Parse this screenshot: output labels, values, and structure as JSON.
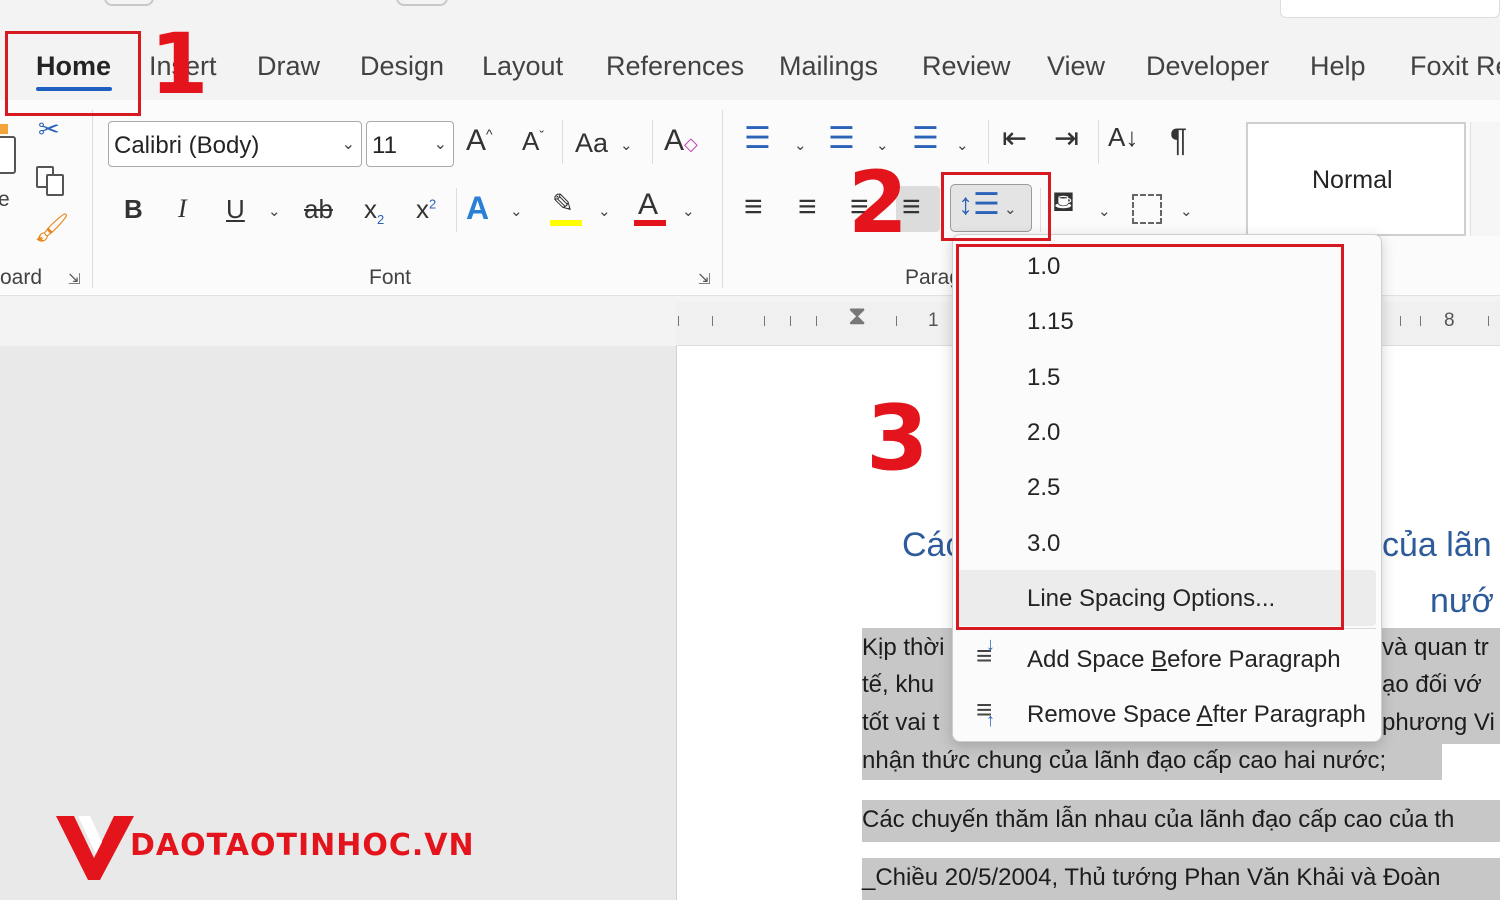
{
  "tabs": [
    {
      "label": "Home",
      "active": true
    },
    {
      "label": "Insert"
    },
    {
      "label": "Draw"
    },
    {
      "label": "Design"
    },
    {
      "label": "Layout"
    },
    {
      "label": "References"
    },
    {
      "label": "Mailings"
    },
    {
      "label": "Review"
    },
    {
      "label": "View"
    },
    {
      "label": "Developer"
    },
    {
      "label": "Help"
    },
    {
      "label": "Foxit Re"
    }
  ],
  "ribbon": {
    "clipboard_label": "oard",
    "clipboard_paste_fragment": "e",
    "font_name": "Calibri (Body)",
    "font_size": "11",
    "change_case": "Aa",
    "font_label": "Font",
    "paragraph_label": "Parag",
    "style_normal": "Normal"
  },
  "ruler": {
    "left_num": "1",
    "right_num": "8"
  },
  "line_spacing_menu": {
    "options": [
      "1.0",
      "1.15",
      "1.5",
      "2.0",
      "2.5",
      "3.0"
    ],
    "options_link": "Line Spacing Options...",
    "add_before_pre": "Add Space ",
    "add_before_key": "B",
    "add_before_post": "efore Paragraph",
    "remove_after_pre": "Remove Space ",
    "remove_after_key": "A",
    "remove_after_post": "fter Paragraph"
  },
  "document": {
    "title_left": "Các",
    "title_right": "của lãn",
    "title_line2": "nướ",
    "lines": [
      {
        "left": "Kịp thời",
        "right": "và quan tr"
      },
      {
        "left": "tế, khu",
        "right": "ạo đối vớ"
      },
      {
        "left": "tốt vai t",
        "right": "phương Vi"
      }
    ],
    "line4": "nhận thức chung của lãnh đạo cấp cao hai nước;",
    "line5": "Các chuyến thăm lẫn nhau của lãnh đạo cấp cao của th",
    "line6": "_Chiều 20/5/2004, Thủ tướng Phan Văn Khải và Đoàn"
  },
  "annotations": {
    "step1": "1",
    "step2": "2",
    "step3": "3",
    "color": "#d71a22"
  },
  "logo": {
    "text": "DAOTAOTINHOC.VN",
    "color": "#e3141b"
  },
  "colors": {
    "accent": "#1f5fbf",
    "heading": "#2e5b9a",
    "highlight": "#ffff00",
    "font_color": "#e3141b"
  }
}
